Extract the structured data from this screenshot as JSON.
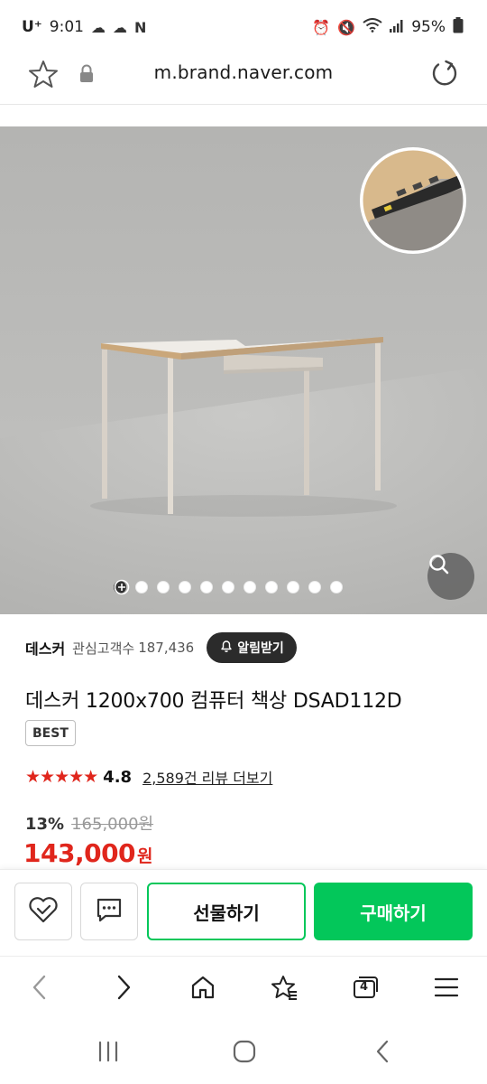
{
  "status_bar": {
    "carrier": "U⁺",
    "time": "9:01",
    "notification_icons": [
      "cloud-icon",
      "cloud-icon",
      "naver-n-icon"
    ],
    "system_icons": [
      "alarm-icon",
      "mute-icon",
      "wifi-icon",
      "signal-icon"
    ],
    "battery": "95%"
  },
  "browser": {
    "url": "m.brand.naver.com",
    "icons": [
      "star-icon",
      "lock-icon",
      "reload-icon"
    ]
  },
  "gallery": {
    "image_count": 11,
    "active_index": 0,
    "more_icon": "plus-circle-icon",
    "zoom_icon": "magnifier-icon"
  },
  "product": {
    "brand": "데스커",
    "fans_label": "관심고객수",
    "fans_count": "187,436",
    "alarm_label": "알림받기",
    "title": "데스커 1200x700 컴퓨터 책상 DSAD112D",
    "badge": "BEST",
    "rating": "4.8",
    "review_link": "2,589건 리뷰 더보기",
    "discount_rate": "13%",
    "original_price": "165,000원",
    "sale_price": "143,000",
    "price_unit": "원"
  },
  "actions": {
    "like_icon": "heart-check-icon",
    "chat_icon": "talk-icon",
    "gift_label": "선물하기",
    "buy_label": "구매하기"
  },
  "toolbar": {
    "tab_count": "4",
    "icons": [
      "back-icon",
      "forward-icon",
      "home-icon",
      "bookmark-star-icon",
      "tabs-icon",
      "menu-icon"
    ]
  },
  "system_nav": {
    "icons": [
      "recents-icon",
      "home-circle-icon",
      "back-chevron-icon"
    ]
  },
  "colors": {
    "accent_green": "#03c75a",
    "price_red": "#e0261c",
    "dark_button": "#2b2b2b"
  }
}
